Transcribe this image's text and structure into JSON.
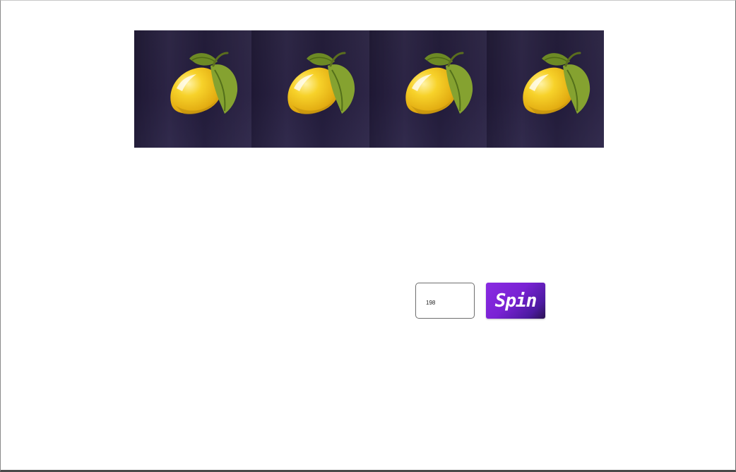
{
  "reels": [
    {
      "symbol": "lemon-icon"
    },
    {
      "symbol": "lemon-icon"
    },
    {
      "symbol": "lemon-icon"
    },
    {
      "symbol": "lemon-icon"
    }
  ],
  "bet": {
    "value": "198"
  },
  "spin_button": {
    "label": "Spin"
  },
  "colors": {
    "reel_background": "#251d3f",
    "lemon": "#f2c31a",
    "leaf": "#7d9a2c",
    "spin_accent": "#8a2be2"
  }
}
